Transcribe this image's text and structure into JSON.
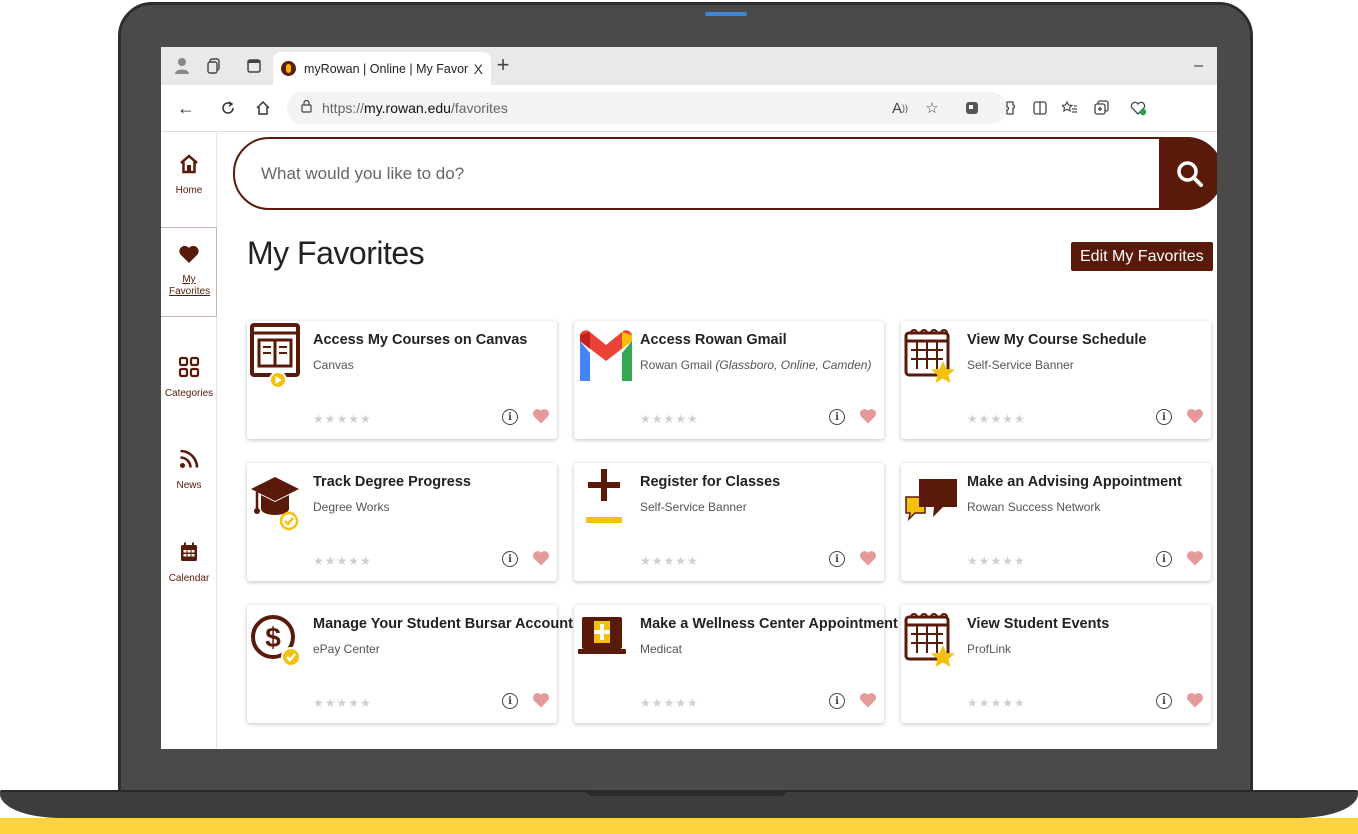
{
  "browser": {
    "tab_title": "myRowan | Online | My Favorites",
    "tab_close": "X",
    "new_tab": "+",
    "minimize": "–",
    "url_prefix": "https://",
    "url_domain": "my.rowan.edu",
    "url_path": "/favorites"
  },
  "sidenav": {
    "items": [
      {
        "label": "Home",
        "icon": "home-icon"
      },
      {
        "label": "My Favorites",
        "icon": "heart-icon"
      },
      {
        "label": "Categories",
        "icon": "grid-icon"
      },
      {
        "label": "News",
        "icon": "rss-icon"
      },
      {
        "label": "Calendar",
        "icon": "calendar-icon"
      }
    ],
    "active": "My Favorites"
  },
  "search": {
    "placeholder": "What would you like to do?"
  },
  "page": {
    "title": "My Favorites",
    "edit_label": "Edit My Favorites"
  },
  "colors": {
    "brand": "#5a1a0a",
    "gold": "#f4c20d",
    "heart": "#e59a9a"
  },
  "cards": [
    {
      "title": "Access My Courses on Canvas",
      "subtitle": "Canvas",
      "subtitle_note": "",
      "icon": "canvas-book-icon"
    },
    {
      "title": "Access Rowan Gmail",
      "subtitle": "Rowan Gmail",
      "subtitle_note": "(Glassboro, Online, Camden)",
      "icon": "gmail-icon"
    },
    {
      "title": "View My Course Schedule",
      "subtitle": "Self-Service Banner",
      "subtitle_note": "",
      "icon": "calendar-star-icon"
    },
    {
      "title": "Track Degree Progress",
      "subtitle": "Degree Works",
      "subtitle_note": "",
      "icon": "graduation-cap-icon"
    },
    {
      "title": "Register for Classes",
      "subtitle": "Self-Service Banner",
      "subtitle_note": "",
      "icon": "plus-minus-icon"
    },
    {
      "title": "Make an Advising Appointment",
      "subtitle": "Rowan Success Network",
      "subtitle_note": "",
      "icon": "chat-bubbles-icon"
    },
    {
      "title": "Manage Your Student Bursar Account",
      "subtitle": "ePay Center",
      "subtitle_note": "",
      "icon": "dollar-check-icon"
    },
    {
      "title": "Make a Wellness Center Appointment",
      "subtitle": "Medicat",
      "subtitle_note": "",
      "icon": "medical-laptop-icon"
    },
    {
      "title": "View Student Events",
      "subtitle": "ProfLink",
      "subtitle_note": "",
      "icon": "calendar-star-icon"
    }
  ]
}
